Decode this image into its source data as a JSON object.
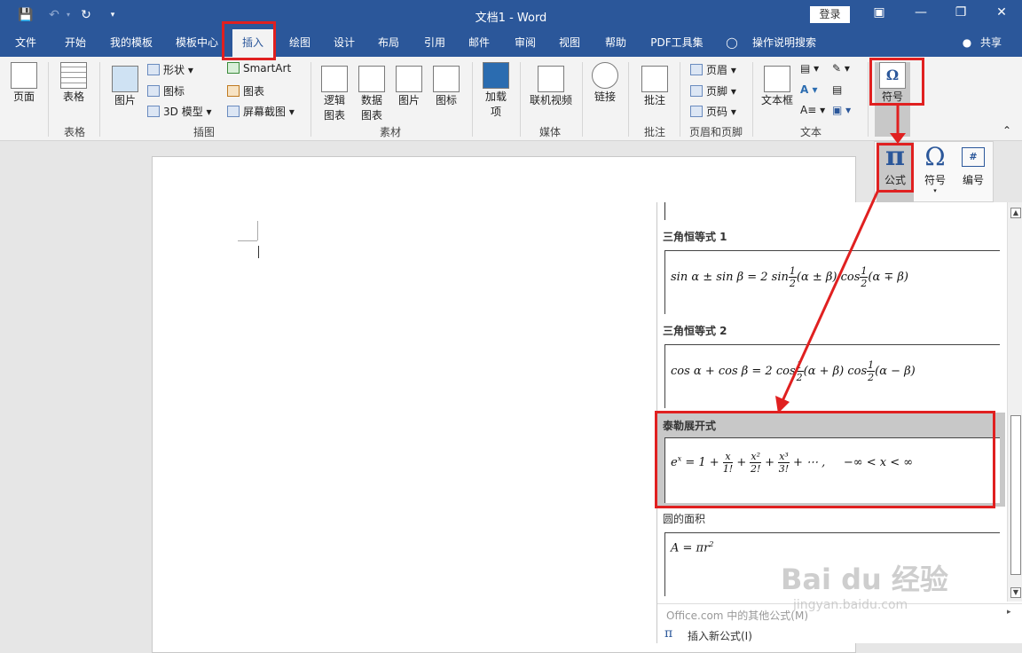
{
  "title_bar": {
    "title": "文档1  -  Word",
    "login": "登录",
    "icons": [
      "save-icon",
      "undo-icon",
      "redo-icon",
      "customize-icon"
    ]
  },
  "tabs": [
    "文件",
    "开始",
    "我的模板",
    "模板中心",
    "插入",
    "绘图",
    "设计",
    "布局",
    "引用",
    "邮件",
    "审阅",
    "视图",
    "帮助",
    "PDF工具集",
    "操作说明搜索",
    "共享"
  ],
  "ribbon": {
    "page": "页面",
    "table": "表格",
    "table_group": "表格",
    "picture": "图片",
    "shapes": "形状",
    "icons": "图标",
    "model3d": "3D 模型",
    "smartart": "SmartArt",
    "chart": "图表",
    "screenshot": "屏幕截图",
    "illustrations_group": "插图",
    "logic_chart": "逻辑\n图表",
    "data_chart": "数据\n图表",
    "pic2": "图片",
    "icon2": "图标",
    "material_group": "素材",
    "addins": "加载\n项",
    "online_video": "联机视频",
    "media_group": "媒体",
    "link": "链接",
    "comment": "批注",
    "comment_group": "批注",
    "header": "页眉",
    "footer": "页脚",
    "page_number": "页码",
    "header_footer_group": "页眉和页脚",
    "textbox": "文本框",
    "text_group": "文本",
    "symbol": "符号"
  },
  "flyout": {
    "equation": "公式",
    "symbol": "符号",
    "number": "编号"
  },
  "gallery": {
    "items": [
      {
        "title": "三角恒等式 1"
      },
      {
        "title": "三角恒等式 2"
      },
      {
        "title": "泰勒展开式"
      },
      {
        "title": "圆的面积"
      }
    ],
    "more": "Office.com 中的其他公式(M)",
    "insert_new": "插入新公式(I)"
  },
  "watermark": {
    "brand": "Bai du 经验",
    "url": "jingyan.baidu.com"
  }
}
